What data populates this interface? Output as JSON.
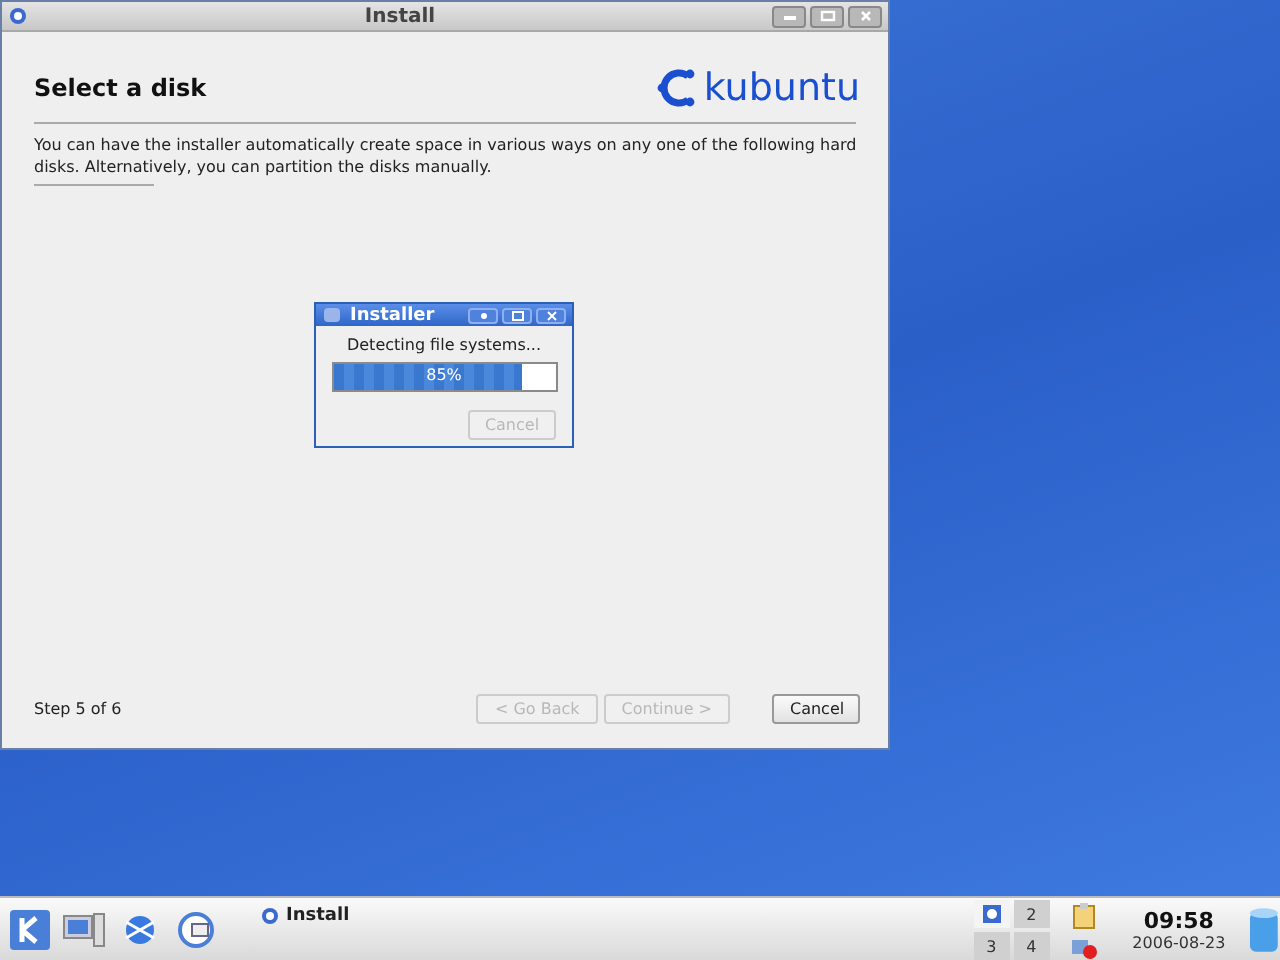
{
  "window": {
    "title": "Install",
    "heading": "Select a disk",
    "logo_text": "kubuntu",
    "description": "You can have the installer automatically create space in various ways on any one of the following hard disks. Alternatively, you can partition the disks manually.",
    "step": "Step 5 of 6",
    "buttons": [
      {
        "label": "< Go Back",
        "disabled": true
      },
      {
        "label": "Continue >",
        "disabled": true
      },
      {
        "label": "Cancel",
        "disabled": false
      }
    ]
  },
  "dialog": {
    "title": "Installer",
    "message": "Detecting file systems...",
    "progress": {
      "level": 0.85,
      "reading": "85%"
    },
    "button": {
      "label": "Cancel",
      "disabled": true
    }
  },
  "taskbar": {
    "task": "Install",
    "pager": [
      {
        "selected": true
      },
      {
        "label": "2",
        "selected": false
      },
      {
        "label": "3",
        "selected": false
      },
      {
        "label": "4",
        "selected": false
      }
    ],
    "clock": {
      "time": "09:58",
      "date": "2006-08-23"
    }
  }
}
